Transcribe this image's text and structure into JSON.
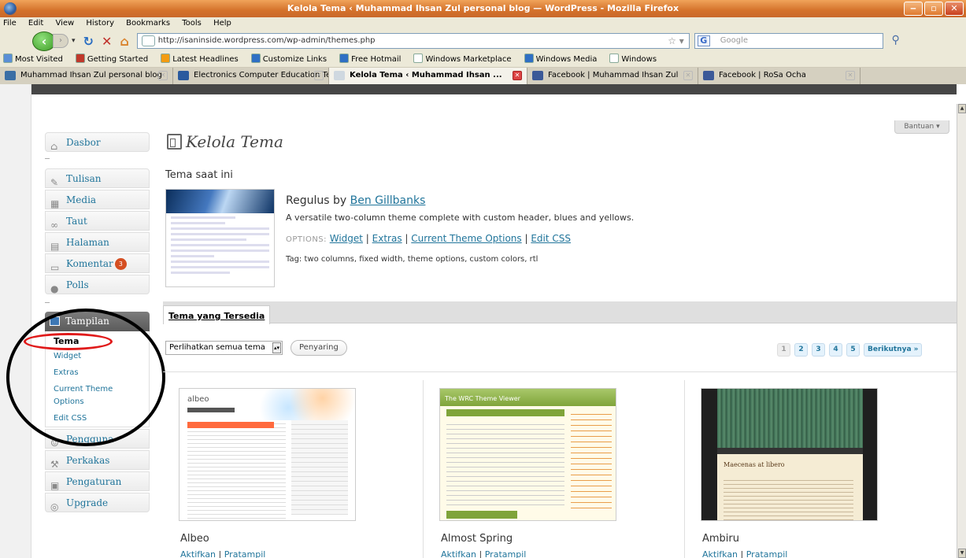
{
  "window": {
    "title": "Kelola Tema ‹ Muhammad Ihsan Zul personal blog — WordPress - Mozilla Firefox",
    "controls": [
      "‒",
      "▫",
      "✕"
    ]
  },
  "menu": [
    "File",
    "Edit",
    "View",
    "History",
    "Bookmarks",
    "Tools",
    "Help"
  ],
  "nav": {
    "url": "http://isaninside.wordpress.com/wp-admin/themes.php",
    "search_placeholder": "Google"
  },
  "bookmarks": [
    {
      "label": "Most Visited",
      "color": "#5a8fd6"
    },
    {
      "label": "Getting Started",
      "color": "#c0392b"
    },
    {
      "label": "Latest Headlines",
      "color": "#f39c12"
    },
    {
      "label": "Customize Links",
      "color": "#2f6fc4"
    },
    {
      "label": "Free Hotmail",
      "color": "#2f6fc4"
    },
    {
      "label": "Windows Marketplace",
      "color": "#ffffff"
    },
    {
      "label": "Windows Media",
      "color": "#2f6fc4"
    },
    {
      "label": "Windows",
      "color": "#ffffff"
    }
  ],
  "tabs": [
    {
      "label": "Muhammad Ihsan Zul personal blog",
      "icon_color": "#3a6ea5"
    },
    {
      "label": "Electronics Computer Education Team",
      "icon_color": "#2a5a9e"
    },
    {
      "label": "Kelola Tema ‹ Muhammad Ihsan ...",
      "icon_color": "#cfd8e0",
      "active": true
    },
    {
      "label": "Facebook | Muhammad Ihsan Zul",
      "icon_color": "#3b5998"
    },
    {
      "label": "Facebook | RoSa Ocha",
      "icon_color": "#3b5998"
    }
  ],
  "help": "Bantuan ▾",
  "sidebar": {
    "dasbor": "Dasbor",
    "tulisan": "Tulisan",
    "media": "Media",
    "taut": "Taut",
    "halaman": "Halaman",
    "komentar": "Komentar",
    "komentar_badge": "3",
    "polls": "Polls",
    "tampilan": "Tampilan",
    "submenu": {
      "tema": "Tema",
      "widget": "Widget",
      "extras": "Extras",
      "current_theme_options_1": "Current Theme",
      "current_theme_options_2": "Options",
      "edit_css": "Edit CSS"
    },
    "pengguna": "Pengguna",
    "perkakas": "Perkakas",
    "pengaturan": "Pengaturan",
    "upgrade": "Upgrade"
  },
  "main": {
    "title": "Kelola Tema",
    "current_heading": "Tema saat ini",
    "current_theme": {
      "name": "Regulus by ",
      "author": "Ben Gillbanks",
      "description": "A versatile two-column theme complete with custom header, blues and yellows.",
      "options_label": "OPTIONS: ",
      "options": [
        "Widget",
        "Extras",
        "Current Theme Options",
        "Edit CSS"
      ],
      "tags": "Tag: two columns, fixed width, theme options, custom colors, rtl"
    },
    "available_tab": "Tema yang Tersedia",
    "filter_select": "Perlihatkan semua tema",
    "filter_button": "Penyaring",
    "pages": [
      "1",
      "2",
      "3",
      "4",
      "5",
      "Berikutnya »"
    ],
    "themes": [
      {
        "name": "Albeo",
        "activate": "Aktifkan",
        "preview": "Pratampil",
        "thumb_text": "albeo"
      },
      {
        "name": "Almost Spring",
        "activate": "Aktifkan",
        "preview": "Pratampil",
        "thumb_text": "The WRC Theme Viewer"
      },
      {
        "name": "Ambiru",
        "activate": "Aktifkan",
        "preview": "Pratampil",
        "thumb_text": "Maecenas at libero"
      }
    ]
  }
}
